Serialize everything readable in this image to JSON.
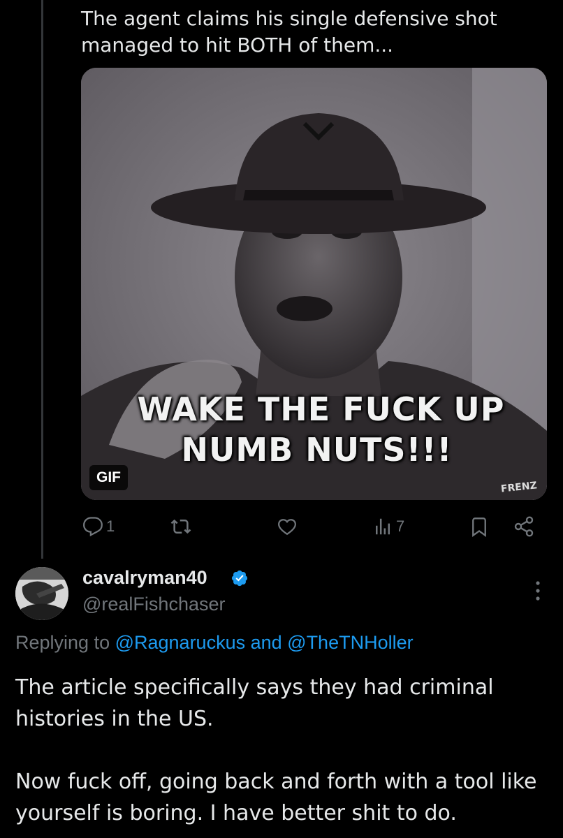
{
  "previous_tweet": {
    "text": "The agent claims his single defensive shot\nmanaged to hit BOTH of them...",
    "media": {
      "caption_line1": "WAKE THE FUCK UP",
      "caption_line2": "NUMB NUTS!!!",
      "watermark": "FRENZ",
      "badge": "GIF"
    },
    "actions": {
      "reply_count": "1",
      "views_count": "7",
      "icons": [
        "reply-icon",
        "retweet-icon",
        "like-icon",
        "views-icon",
        "bookmark-icon",
        "share-icon"
      ]
    }
  },
  "reply": {
    "display_name": "cavalryman40",
    "verified": true,
    "handle": "@realFishchaser",
    "replying_prefix": "Replying to ",
    "mention1": "@Ragnaruckus",
    "replying_and": " and ",
    "mention2": "@TheTNHoller",
    "paragraph1": "The article specifically says they had criminal histories in the US.",
    "paragraph2": "Now fuck off, going back and forth with a tool like yourself is boring. I have better shit to do."
  },
  "colors": {
    "background": "#000000",
    "text_primary": "#e7e9ea",
    "text_secondary": "#71767b",
    "accent": "#1d9bf0",
    "thread_line": "#333639"
  }
}
